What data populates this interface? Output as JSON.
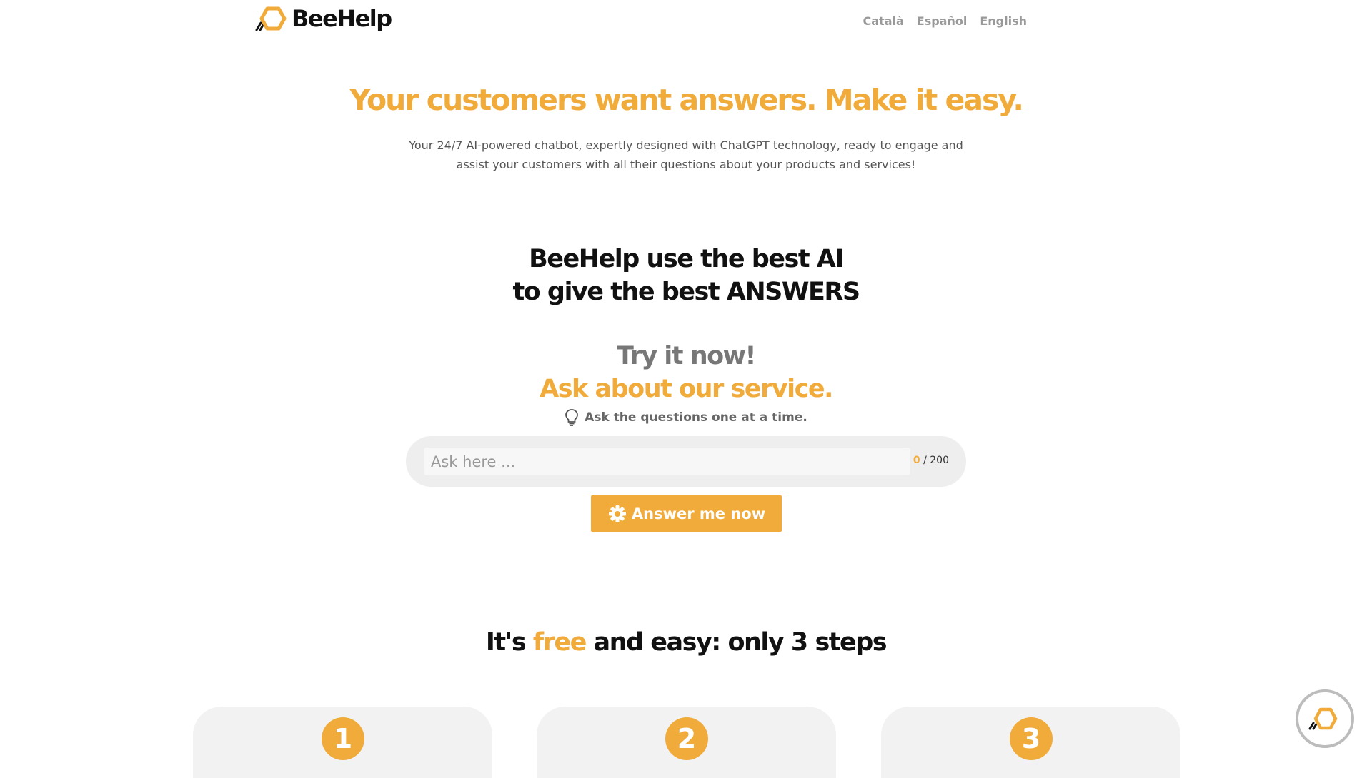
{
  "colors": {
    "accent": "#f0ab3b",
    "text_dark": "#111111",
    "text_muted": "#777777",
    "nav_text": "#999999",
    "input_bg": "#eeeeee",
    "card_bg": "#f2f2f2"
  },
  "header": {
    "logo_text": "BeeHelp",
    "logo_icon": "hexagon-logo-icon",
    "languages": [
      "Català",
      "Español",
      "English"
    ]
  },
  "hero": {
    "title": "Your customers want answers. Make it easy.",
    "subtitle": "Your 24/7 AI-powered chatbot, expertly designed with ChatGPT technology, ready to engage and assist your customers with all their questions about your products and services!"
  },
  "best_ai": {
    "line1": "BeeHelp use the best AI",
    "line2": "to give the best ANSWERS"
  },
  "try_now": {
    "line1": "Try it now!",
    "line2": "Ask about our service."
  },
  "hint": {
    "icon": "lightbulb-icon",
    "text": "Ask the questions one at a time."
  },
  "ask": {
    "placeholder": "Ask here ...",
    "value": "",
    "count": "0",
    "max": "/ 200"
  },
  "answer_button": {
    "icon": "gear-icon",
    "label": "Answer me now"
  },
  "steps": {
    "title_pre": "It's ",
    "title_free": "free",
    "title_post": " and easy: only 3 steps",
    "numbers": [
      "1",
      "2",
      "3"
    ]
  },
  "chat_widget": {
    "icon": "hexagon-logo-icon"
  }
}
